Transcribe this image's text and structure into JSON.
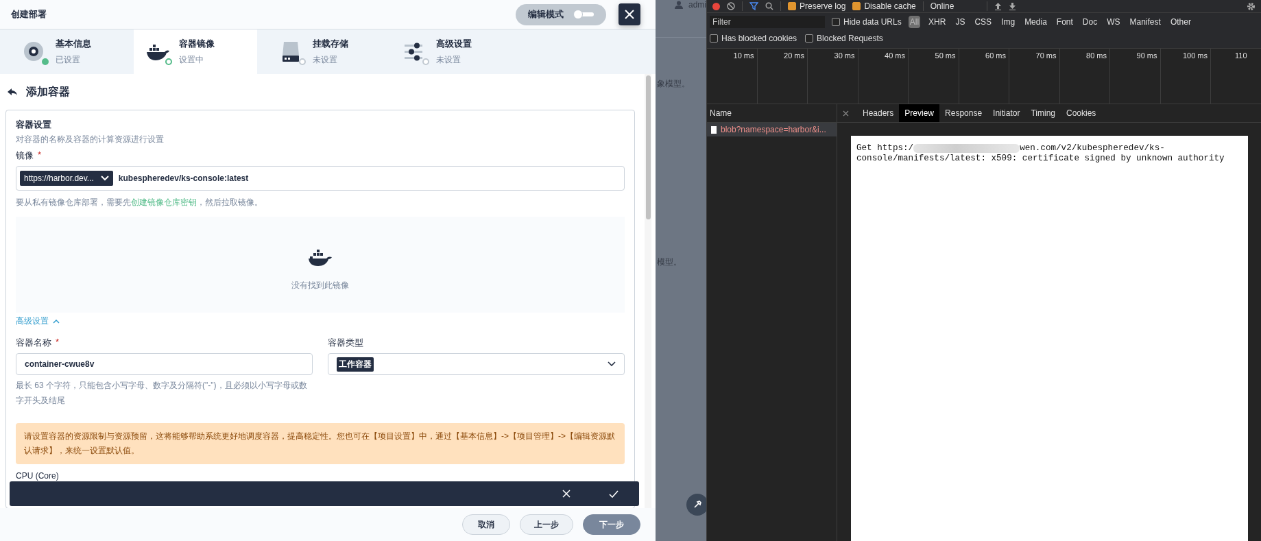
{
  "modal": {
    "title": "创建部署",
    "edit_mode": {
      "label": "编辑模式",
      "on": false
    }
  },
  "steps": [
    {
      "title": "基本信息",
      "status": "已设置",
      "kind": "info",
      "completed": true,
      "selected": false
    },
    {
      "title": "容器镜像",
      "status": "设置中",
      "kind": "image",
      "completed": false,
      "selected": true
    },
    {
      "title": "挂载存储",
      "status": "未设置",
      "kind": "storage",
      "completed": false,
      "selected": false
    },
    {
      "title": "高级设置",
      "status": "未设置",
      "kind": "advanced",
      "completed": false,
      "selected": false
    }
  ],
  "back_title": "添加容器",
  "section": {
    "title": "容器设置",
    "description": "对容器的名称及容器的计算资源进行设置"
  },
  "image": {
    "label": "镜像",
    "required": "*",
    "registry": "https://harbor.dev...",
    "value": "kubespheredev/ks-console:latest"
  },
  "hint": {
    "before": "要从私有镜像仓库部署，需要先",
    "link": "创建镜像仓库密钥",
    "after": "，然后拉取镜像。"
  },
  "empty_state": "没有找到此镜像",
  "advanced_toggle": {
    "label": "高级设置",
    "expanded": true
  },
  "name_field": {
    "label": "容器名称",
    "required": "*",
    "value": "container-cwue8v",
    "help": "最长 63 个字符，只能包含小写字母、数字及分隔符(\"-\")，且必须以小写字母或数字开头及结尾"
  },
  "type_field": {
    "label": "容器类型",
    "value": "工作容器"
  },
  "notice": "请设置容器的资源限制与资源预留，这将能够帮助系统更好地调度容器，提高稳定性。您也可在【项目设置】中，通过【基本信息】->【项目管理】->【编辑资源默认请求】，来统一设置默认值。",
  "cpu_label": "CPU (Core)",
  "footer": [
    {
      "label": "取消",
      "kind": "default"
    },
    {
      "label": "上一步",
      "kind": "default"
    },
    {
      "label": "下一步",
      "kind": "primary"
    }
  ],
  "backdrop": {
    "user": "admi",
    "texts": [
      "象模型。",
      "模型。"
    ]
  },
  "devtools": {
    "preserve_log": {
      "label": "Preserve log",
      "checked": true
    },
    "disable_cache": {
      "label": "Disable cache",
      "checked": true
    },
    "throttle": "Online",
    "filter": {
      "placeholder": "Filter"
    },
    "hide_data_urls": {
      "label": "Hide data URLs",
      "checked": false
    },
    "type_filters": [
      {
        "label": "All",
        "selected": true
      },
      {
        "label": "XHR",
        "selected": false
      },
      {
        "label": "JS",
        "selected": false
      },
      {
        "label": "CSS",
        "selected": false
      },
      {
        "label": "Img",
        "selected": false
      },
      {
        "label": "Media",
        "selected": false
      },
      {
        "label": "Font",
        "selected": false
      },
      {
        "label": "Doc",
        "selected": false
      },
      {
        "label": "WS",
        "selected": false
      },
      {
        "label": "Manifest",
        "selected": false
      },
      {
        "label": "Other",
        "selected": false
      }
    ],
    "blocked_cookies": {
      "label": "Has blocked cookies",
      "checked": false
    },
    "blocked_requests": {
      "label": "Blocked Requests",
      "checked": false
    },
    "ticks": [
      "10 ms",
      "20 ms",
      "30 ms",
      "40 ms",
      "50 ms",
      "60 ms",
      "70 ms",
      "80 ms",
      "90 ms",
      "100 ms",
      "110"
    ],
    "name_header": "Name",
    "requests": [
      {
        "name": "blob?namespace=harbor&i...",
        "failed": true,
        "selected": true
      }
    ],
    "tabs": [
      {
        "label": "Headers",
        "selected": false
      },
      {
        "label": "Preview",
        "selected": true
      },
      {
        "label": "Response",
        "selected": false
      },
      {
        "label": "Initiator",
        "selected": false
      },
      {
        "label": "Timing",
        "selected": false
      },
      {
        "label": "Cookies",
        "selected": false
      }
    ],
    "preview": {
      "prefix": "Get https:/",
      "lines": [
        "wen.com/v2/kubespheredev/ks-",
        "console/manifests/latest: x509: certificate signed by unknown authority"
      ]
    }
  }
}
